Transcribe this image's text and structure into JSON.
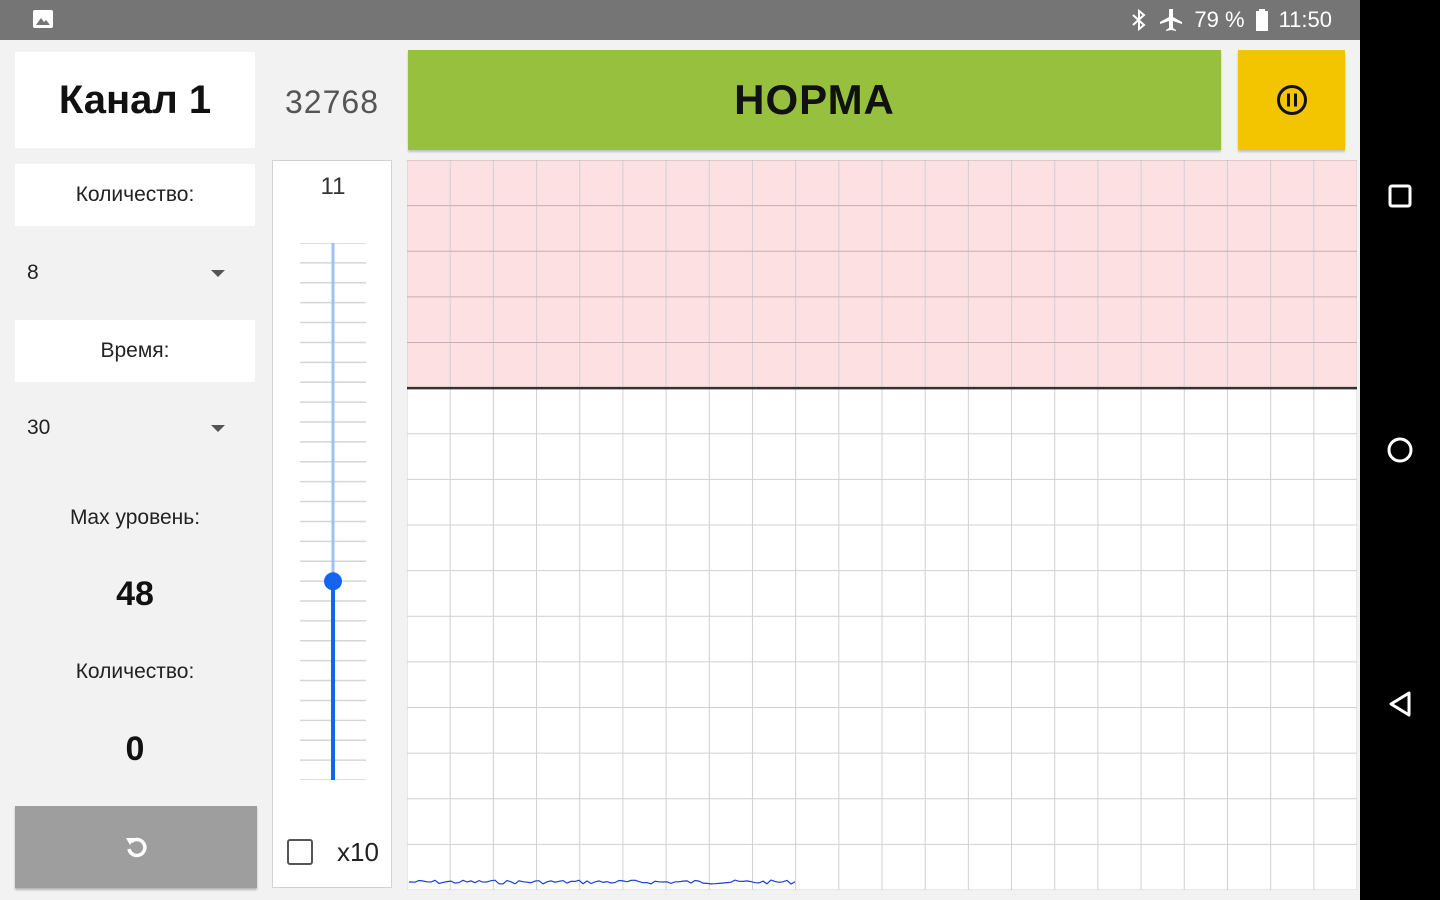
{
  "status_bar": {
    "battery": "79 %",
    "time": "11:50",
    "icons": [
      "gallery-icon",
      "bluetooth-icon",
      "airplane-icon",
      "battery-icon"
    ]
  },
  "nav_bar": {
    "icons": [
      "recent-apps-icon",
      "home-icon",
      "back-icon"
    ]
  },
  "left_panel": {
    "channel_title": "Канал 1",
    "count_label": "Количество:",
    "count_select": "8",
    "time_label": "Время:",
    "time_select": "30",
    "max_level_label": "Max уровень:",
    "max_level_value": "48",
    "quantity_label": "Количество:",
    "quantity_value": "0",
    "reset_icon": "reset-icon"
  },
  "counter_value": "32768",
  "slider": {
    "value": "11",
    "level_fraction": 0.37,
    "x10_label": "x10",
    "x10_checked": false
  },
  "status": {
    "text": "НОРМА",
    "color": "#97c03f"
  },
  "pause_button": {
    "icon": "pause-circle-icon",
    "color": "#f2c500"
  },
  "graph": {
    "alarm_zone_color": "#fde0e1",
    "signal_color": "#1a3fd6"
  }
}
